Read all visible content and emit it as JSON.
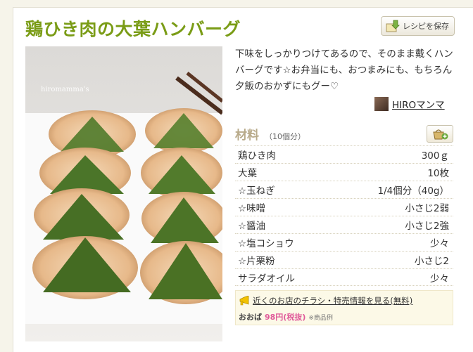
{
  "recipe": {
    "title": "鶏ひき肉の大葉ハンバーグ",
    "save_label": "レシピを保存",
    "photo_watermark": "hiromamma's",
    "description": "下味をしっかりつけてあるので、そのまま戴くハンバーグです☆お弁当にも、おつまみにも、もちろん夕飯のおかずにもグー♡",
    "author_name": "HIROマンマ"
  },
  "ingredients": {
    "label": "材料",
    "count": "（10個分）",
    "items": [
      {
        "name": "鶏ひき肉",
        "amount": "300ｇ"
      },
      {
        "name": "大葉",
        "amount": "10枚"
      },
      {
        "name": "☆玉ねぎ",
        "amount": "1/4個分（40g）"
      },
      {
        "name": "☆味噌",
        "amount": "小さじ2弱"
      },
      {
        "name": "☆醤油",
        "amount": "小さじ2強"
      },
      {
        "name": "☆塩コショウ",
        "amount": "少々"
      },
      {
        "name": "☆片栗粉",
        "amount": "小さじ2"
      },
      {
        "name": "サラダオイル",
        "amount": "少々"
      }
    ]
  },
  "promo": {
    "link_text": "近くのお店のチラシ・特売情報を見る(無料)",
    "shop": "おおば",
    "price": "98円(税抜)",
    "note": "※商品例"
  },
  "colors": {
    "title": "#7a9c16",
    "ingredient_label": "#b8aa8a",
    "price": "#e05a9a",
    "promo_bg": "#fcf9e7"
  },
  "icons": [
    "save-recipe-icon",
    "add-to-basket-icon",
    "flyer-megaphone-icon",
    "author-avatar"
  ]
}
